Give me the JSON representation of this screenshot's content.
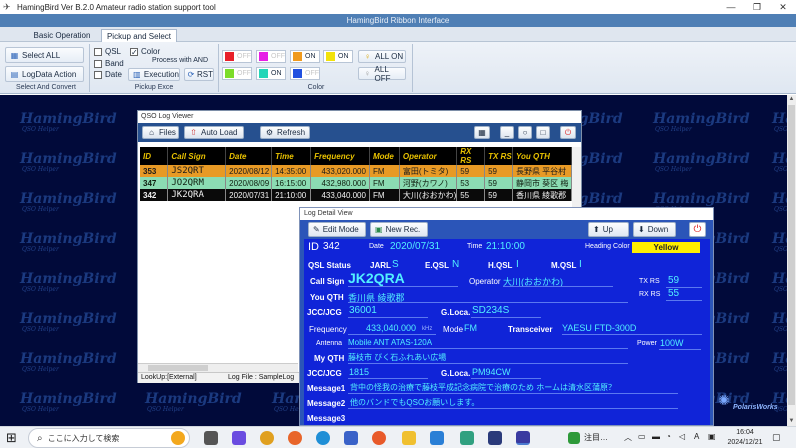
{
  "window": {
    "title": "HamingBird Ver B.2.0   Amateur radio station support tool",
    "minimize_icon": "minimize-icon",
    "maximize_icon": "restore-icon",
    "close_icon": "close-icon"
  },
  "ribbon_header": "HamingBird Ribbon Interface",
  "tabs": [
    {
      "label": "Basic Operation"
    },
    {
      "label": "Pickup and Select"
    }
  ],
  "ribbon": {
    "select_all": "Select ALL",
    "logdata_action": "LogData Action",
    "group_select": "Select And Convert",
    "checks": {
      "qsl": "QSL",
      "color": "Color",
      "band": "Band",
      "date": "Date",
      "process_with_and": "Process with AND",
      "qsl_checked": false,
      "color_checked": true,
      "band_checked": false,
      "date_checked": false
    },
    "execution": "Execution",
    "rst": "RST",
    "group_pickup": "Pickup Exce",
    "color_buttons": [
      {
        "label": "OFF",
        "swatch": "#e8202a",
        "on": false
      },
      {
        "label": "OFF",
        "swatch": "#e61ee6",
        "on": false
      },
      {
        "label": "ON",
        "swatch": "#f09a1e",
        "on": true
      },
      {
        "label": "ON",
        "swatch": "#f2e20a",
        "on": true
      },
      {
        "label": "OFF",
        "swatch": "#7cdc2a",
        "on": false
      },
      {
        "label": "ON",
        "swatch": "#24d6b8",
        "on": true
      },
      {
        "label": "OFF",
        "swatch": "#2050e0",
        "on": false
      }
    ],
    "all_on": "ALL ON",
    "all_off": "ALL OFF",
    "group_color": "Color"
  },
  "watermark": {
    "text": "HamingBird",
    "sub": "QSO Helper"
  },
  "qso_viewer": {
    "title": "QSO Log Viewer",
    "files_btn": "Files",
    "autoload_btn": "Auto Load",
    "refresh_btn": "Refresh",
    "columns": [
      "ID",
      "Call Sign",
      "Date",
      "Time",
      "Frequency",
      "Mode",
      "Operator",
      "RX RS",
      "TX RS",
      "You QTH"
    ],
    "rows": [
      {
        "id": "353",
        "call": "JS2QRT",
        "date": "2020/08/12",
        "time": "14:35:00",
        "freq": "433,020.000",
        "mode": "FM",
        "op": "富田(トミタ)",
        "rx": "59",
        "tx": "59",
        "qth": "長野県 平谷村"
      },
      {
        "id": "347",
        "call": "JO2QRM",
        "date": "2020/08/09",
        "time": "16:15:00",
        "freq": "432,980.000",
        "mode": "FM",
        "op": "河野(カワノ)",
        "rx": "53",
        "tx": "59",
        "qth": "静岡市 葵区 梅"
      },
      {
        "id": "342",
        "call": "JK2QRA",
        "date": "2020/07/31",
        "time": "21:10:00",
        "freq": "433,040.000",
        "mode": "FM",
        "op": "大川(おおかわ)",
        "rx": "55",
        "tx": "59",
        "qth": "香川県 綾歌郡"
      }
    ],
    "status_lookup": "LookUp:[External]",
    "status_logfile": "Log File : SampleLog"
  },
  "detail": {
    "title": "Log Detail View",
    "edit_mode": "Edit Mode",
    "new_rec": "New Rec.",
    "up": "Up",
    "down": "Down",
    "id_label": "ID",
    "id": "342",
    "date_label": "Date",
    "date": "2020/07/31",
    "time_label": "Time",
    "time": "21:10:00",
    "heading_color_label": "Heading Color",
    "heading_color": "Yellow",
    "qsl_status_label": "QSL Status",
    "jarl_label": "JARL",
    "jarl": "S",
    "eqsl_label": "E.QSL",
    "eqsl": "N",
    "hqsl_label": "H.QSL",
    "hqsl": "I",
    "mqsl_label": "M.QSL",
    "mqsl": "I",
    "callsign_label": "Call Sign",
    "callsign": "JK2QRA",
    "operator_label": "Operator",
    "operator": "大川(おおかわ)",
    "tx_rs_label": "TX RS",
    "tx_rs": "59",
    "rx_rs_label": "RX RS",
    "rx_rs": "55",
    "you_qth_label": "You QTH",
    "you_qth": "香川県 綾歌郡",
    "jcc_label": "JCC/JCG",
    "jcc": "36001",
    "gloca_label": "G.Loca.",
    "gloca": "SD234S",
    "freq_label": "Frequency",
    "freq": "433,040.000",
    "freq_unit": "kHz",
    "mode_label": "Mode",
    "mode": "FM",
    "transceiver_label": "Transceiver",
    "transceiver": "YAESU FTD-300D",
    "antenna_label": "Antenna",
    "antenna": "Mobile  ANT ATAS-120A",
    "power_label": "Power",
    "power": "100W",
    "my_qth_label": "My QTH",
    "my_qth": "藤枝市 びく石ふれあい広場",
    "my_jcc_label": "JCC/JCG",
    "my_jcc": "1815",
    "my_gloca_label": "G.Loca.",
    "my_gloca": "PM94CW",
    "message1_label": "Message1",
    "message1": "背中の怪我の治療で藤枝平成記念病院で治療のため ホームは清水区蒲原？",
    "message2_label": "Message2",
    "message2": "他のバンドでもQSOお願いします。",
    "message3_label": "Message3",
    "message3": "",
    "logo": "PolarisWorks"
  },
  "taskbar": {
    "search_placeholder": "ここに入力して検索",
    "notification": "注目…",
    "ime": "A",
    "time": "16:04",
    "date": "2024/12/21"
  }
}
